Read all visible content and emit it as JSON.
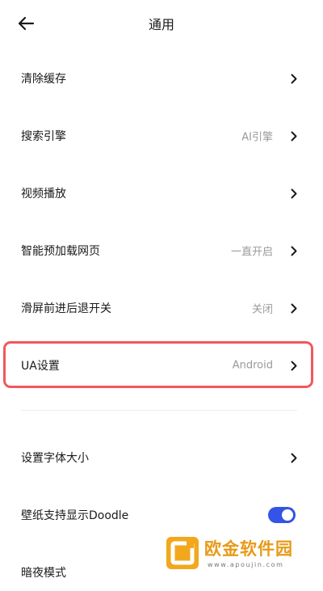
{
  "header": {
    "title": "通用",
    "back_icon": "arrow-left-icon"
  },
  "settings": [
    {
      "id": "clear-cache",
      "label": "清除缓存",
      "value": ""
    },
    {
      "id": "search-engine",
      "label": "搜索引擎",
      "value": "AI引擎"
    },
    {
      "id": "video-playback",
      "label": "视频播放",
      "value": ""
    },
    {
      "id": "smart-preload",
      "label": "智能预加载网页",
      "value": "一直开启"
    },
    {
      "id": "swipe-nav",
      "label": "滑屏前进后退开关",
      "value": "关闭"
    },
    {
      "id": "ua-settings",
      "label": "UA设置",
      "value": "Android"
    },
    {
      "id": "font-size",
      "label": "设置字体大小",
      "value": ""
    },
    {
      "id": "wallpaper-doodle",
      "label": "壁纸支持显示Doodle",
      "toggle": true
    },
    {
      "id": "dark-mode",
      "label": "暗夜模式",
      "value": ""
    }
  ],
  "colors": {
    "toggle_on": "#3354e6",
    "highlight_border": "#f2575d",
    "secondary_text": "#9a9a9a"
  },
  "watermark": {
    "title": "欧金软件园",
    "url": "www.apoujin.com"
  }
}
